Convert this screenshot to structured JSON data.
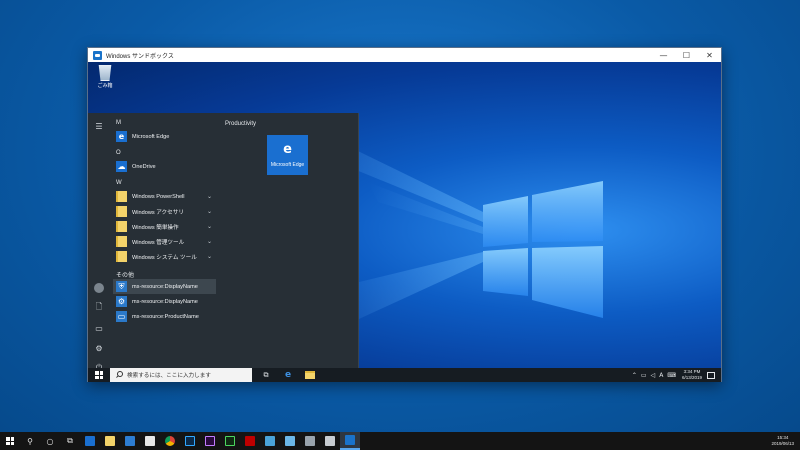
{
  "window": {
    "title": "Windows サンドボックス",
    "controls": [
      "—",
      "☐",
      "✕"
    ]
  },
  "guest_desktop": {
    "recycle_bin_label": "ごみ箱"
  },
  "start_menu": {
    "tiles_header": "Productivity",
    "tile_label": "Microsoft Edge",
    "groups": [
      {
        "letter": "M",
        "items": [
          {
            "label": "Microsoft Edge",
            "icon": "edge-icon"
          }
        ]
      },
      {
        "letter": "O",
        "items": [
          {
            "label": "OneDrive",
            "icon": "onedrive-icon"
          }
        ]
      },
      {
        "letter": "W",
        "items": [
          {
            "label": "Windows PowerShell",
            "icon": "folder-icon",
            "expandable": true
          },
          {
            "label": "Windows アクセサリ",
            "icon": "folder-icon",
            "expandable": true
          },
          {
            "label": "Windows 簡単操作",
            "icon": "folder-icon",
            "expandable": true
          },
          {
            "label": "Windows 管理ツール",
            "icon": "folder-icon",
            "expandable": true
          },
          {
            "label": "Windows システム ツール",
            "icon": "folder-icon",
            "expandable": true
          }
        ]
      },
      {
        "letter": "その他",
        "items": [
          {
            "label": "ms-resource:DisplayName",
            "icon": "shield-icon",
            "selected": true
          },
          {
            "label": "ms-resource:DisplayName",
            "icon": "gear-icon"
          },
          {
            "label": "ms-resource:ProductName",
            "icon": "monitor-icon"
          }
        ]
      }
    ]
  },
  "guest_taskbar": {
    "search_placeholder": "検索するには、ここに入力します",
    "tray_ime": "A",
    "time": "3:34 PM",
    "date": "6/13/2019"
  },
  "host_taskbar": {
    "time": "15:34",
    "date": "2019/06/13"
  }
}
